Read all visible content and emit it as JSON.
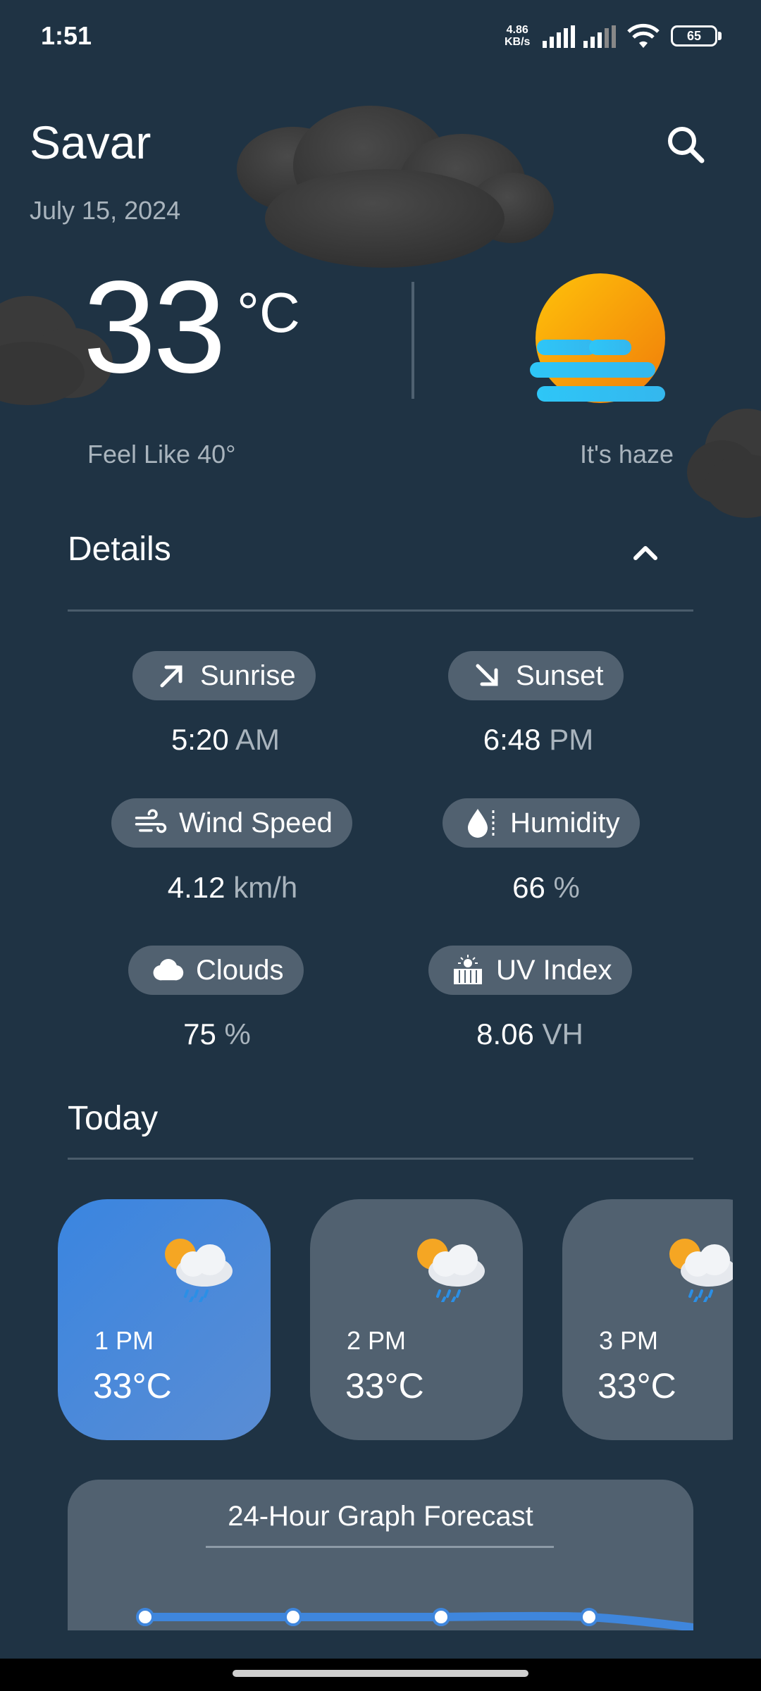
{
  "status": {
    "time": "1:51",
    "net_speed_value": "4.86",
    "net_speed_unit": "KB/s",
    "battery": "65"
  },
  "header": {
    "city": "Savar",
    "date": "July 15, 2024"
  },
  "current": {
    "temp": "33",
    "unit": "°C",
    "feels_like": "Feel Like 40°",
    "condition": "It's haze"
  },
  "details": {
    "title": "Details",
    "items": [
      {
        "label": "Sunrise",
        "value": "5:20",
        "unit": " AM",
        "icon": "arrow-up-right-icon"
      },
      {
        "label": "Sunset",
        "value": "6:48",
        "unit": " PM",
        "icon": "arrow-down-right-icon"
      },
      {
        "label": "Wind Speed",
        "value": "4.12",
        "unit": " km/h",
        "icon": "wind-icon"
      },
      {
        "label": "Humidity",
        "value": "66",
        "unit": " %",
        "icon": "humidity-icon"
      },
      {
        "label": "Clouds",
        "value": "75",
        "unit": " %",
        "icon": "cloud-icon"
      },
      {
        "label": "UV Index",
        "value": "8.06",
        "unit": " VH",
        "icon": "uv-index-icon"
      }
    ]
  },
  "today": {
    "title": "Today",
    "hours": [
      {
        "time": "1 PM",
        "temp": "33°C",
        "icon": "sun-cloud-rain-icon",
        "active": true
      },
      {
        "time": "2 PM",
        "temp": "33°C",
        "icon": "sun-cloud-rain-icon",
        "active": false
      },
      {
        "time": "3 PM",
        "temp": "33°C",
        "icon": "sun-cloud-rain-icon",
        "active": false
      }
    ]
  },
  "graph": {
    "title": "24-Hour Graph Forecast"
  },
  "colors": {
    "background": "#1f3344",
    "pill": "#516170",
    "accent": "#3a85e0",
    "muted_text": "#a9b4bd"
  }
}
